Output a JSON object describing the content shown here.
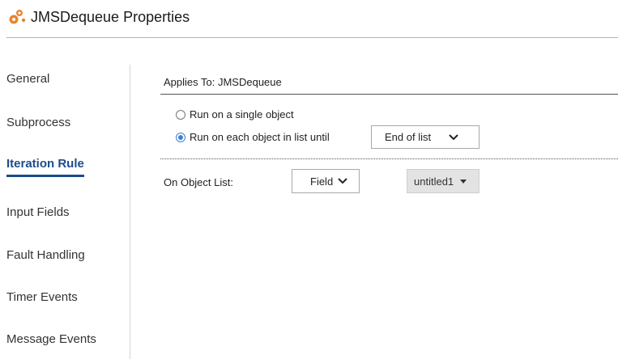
{
  "header": {
    "title": "JMSDequeue Properties",
    "icon": "gears-icon"
  },
  "sidebar": {
    "items": [
      {
        "label": "General",
        "active": false
      },
      {
        "label": "Subprocess",
        "active": false
      },
      {
        "label": "Iteration Rule",
        "active": true
      },
      {
        "label": "Input Fields",
        "active": false
      },
      {
        "label": "Fault Handling",
        "active": false
      },
      {
        "label": "Timer Events",
        "active": false
      },
      {
        "label": "Message Events",
        "active": false
      }
    ]
  },
  "main": {
    "applies_to": "Applies To: JMSDequeue",
    "options": [
      {
        "label": "Run on a single object",
        "checked": false
      },
      {
        "label": "Run on each object in list until",
        "checked": true
      }
    ],
    "until_select": "End of list",
    "object_list_label": "On Object List:",
    "object_list_type": "Field",
    "object_list_value": "untitled1"
  },
  "colors": {
    "accent": "#1c4c8a",
    "radio": "#3c7fd8",
    "icon_orange": "#e8862b"
  }
}
